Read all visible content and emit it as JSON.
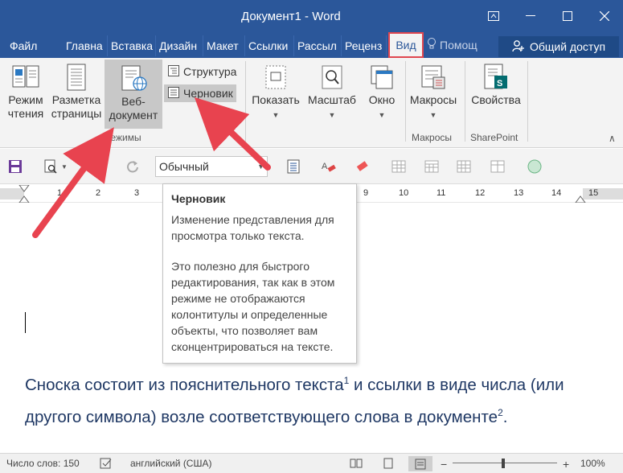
{
  "window": {
    "title": "Документ1 - Word"
  },
  "tabs": [
    {
      "label": "Файл"
    },
    {
      "label": "Главна"
    },
    {
      "label": "Вставка"
    },
    {
      "label": "Дизайн"
    },
    {
      "label": "Макет"
    },
    {
      "label": "Ссылки"
    },
    {
      "label": "Рассыл"
    },
    {
      "label": "Реценз"
    },
    {
      "label": "Вид"
    }
  ],
  "tell_me": "Помощ",
  "share": "Общий доступ",
  "ribbon": {
    "read_mode": [
      "Режим",
      "чтения"
    ],
    "print_layout": [
      "Разметка",
      "страницы"
    ],
    "web_layout": [
      "Веб-",
      "документ"
    ],
    "outline": "Структура",
    "draft": "Черновик",
    "show": "Показать",
    "zoom": "Масштаб",
    "window": "Окно",
    "macros": "Макросы",
    "properties": "Свойства",
    "group_views": "Режимы",
    "group_macros": "Макросы",
    "group_sharepoint": "SharePoint"
  },
  "toolbar": {
    "style_value": "Обычный"
  },
  "ruler": {
    "ticks": [
      "1",
      "2",
      "3",
      "9",
      "10",
      "11",
      "12",
      "13",
      "14",
      "15"
    ]
  },
  "tooltip": {
    "title": "Черновик",
    "p1": "Изменение представления для просмотра только текста.",
    "p2": "Это полезно для быстрого редактирования, так как в этом режиме не отображаются колонтитулы и определенные объекты, что позволяет вам сконцентрироваться на тексте."
  },
  "document": {
    "line1a": "Сноска состоит из пояснительного текста",
    "sup1": "1",
    "line1b": " и ссылки в виде числа (или другого символа) возле соответствующего слова в документе",
    "sup2": "2",
    "line1c": "."
  },
  "status": {
    "words": "Число слов: 150",
    "language": "английский (США)",
    "zoom": "100%"
  },
  "colors": {
    "accent": "#2b579a",
    "highlight": "#e0464f",
    "arrow": "#e8434f",
    "text": "#1f3864"
  }
}
